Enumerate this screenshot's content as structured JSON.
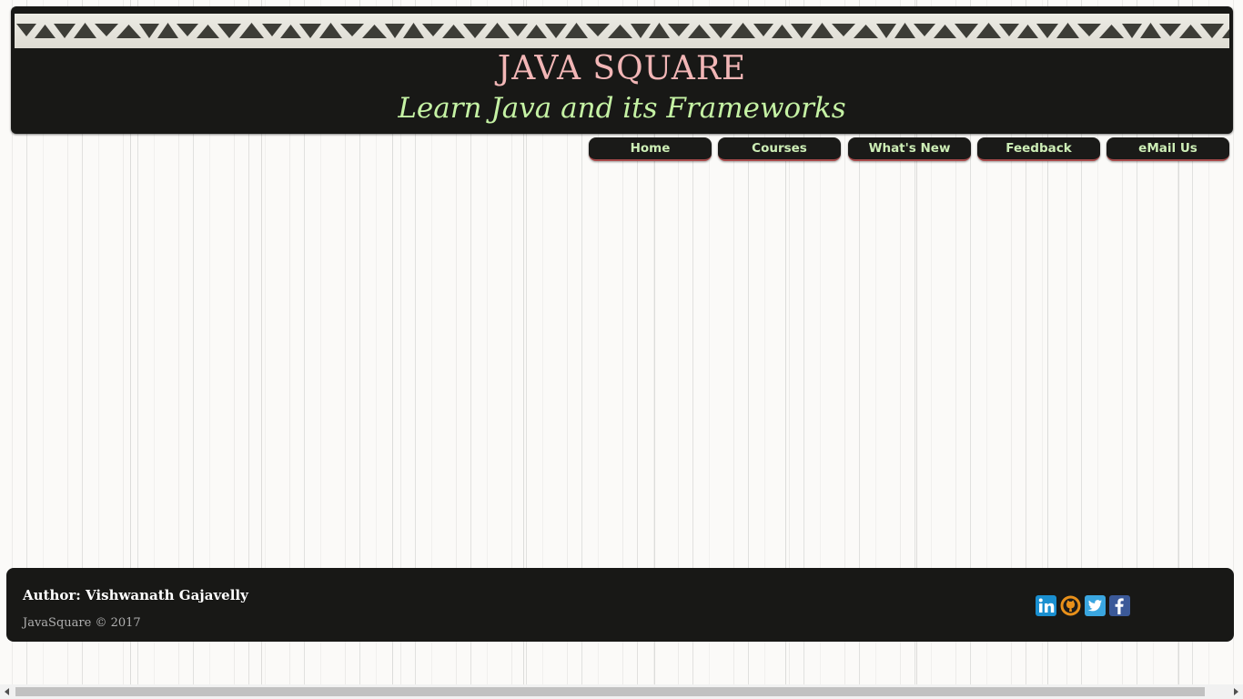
{
  "header": {
    "title": "JAVA SQUARE",
    "tagline": "Learn Java and its Frameworks",
    "title_color": "#f2b6b6",
    "tagline_color": "#c5f2a4"
  },
  "nav": {
    "items": [
      {
        "label": "Home"
      },
      {
        "label": "Courses"
      },
      {
        "label": "What's New"
      },
      {
        "label": "Feedback"
      },
      {
        "label": "eMail Us"
      }
    ],
    "text_color": "#cdeeb6",
    "accent": "#a84a4a"
  },
  "footer": {
    "author": "Author: Vishwanath Gajavelly",
    "copyright": "JavaSquare © 2017",
    "social": [
      {
        "icon": "linkedin-icon",
        "color": "#1a8fd0"
      },
      {
        "icon": "github-icon",
        "color": "#e8901a"
      },
      {
        "icon": "twitter-icon",
        "color": "#3aa6e0"
      },
      {
        "icon": "facebook-icon",
        "color": "#3b5998"
      }
    ]
  }
}
